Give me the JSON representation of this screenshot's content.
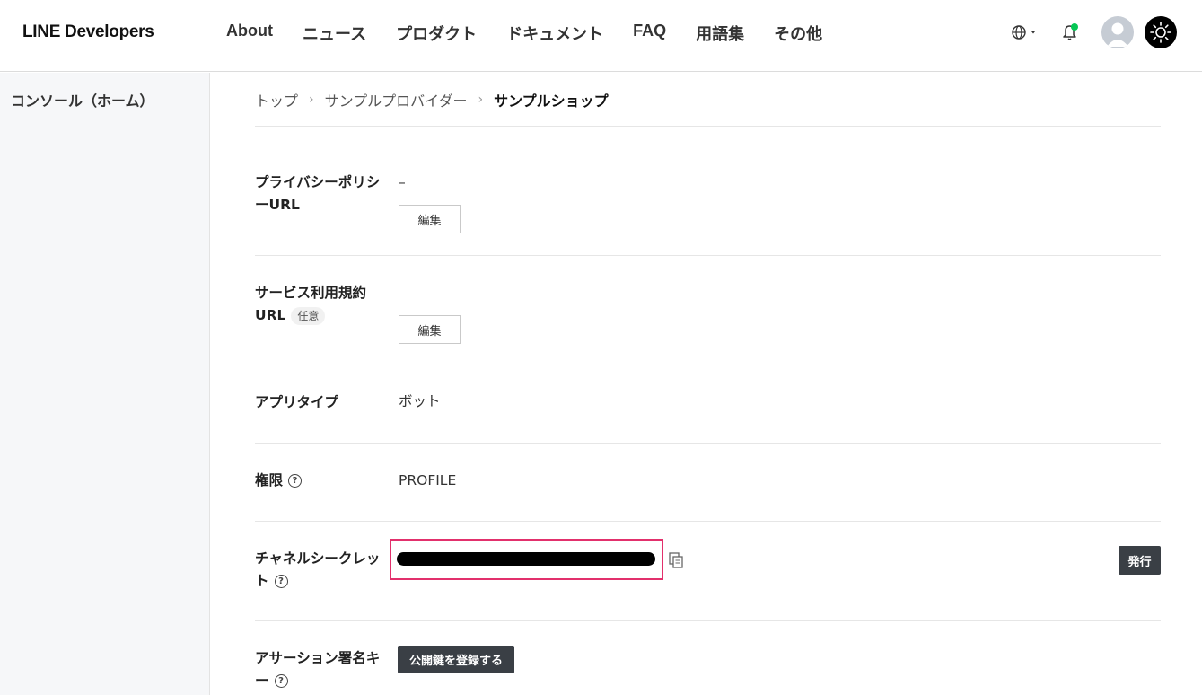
{
  "header": {
    "logo": "LINE Developers",
    "nav": [
      "About",
      "ニュース",
      "プロダクト",
      "ドキュメント",
      "FAQ",
      "用語集",
      "その他"
    ],
    "icons": {
      "globe": "globe-icon",
      "bell": "bell-icon",
      "avatar": "avatar",
      "theme": "sun-icon"
    },
    "colors": {
      "notification_dot": "#06c755"
    }
  },
  "sidebar": {
    "items": [
      {
        "label": "コンソール（ホーム）"
      }
    ]
  },
  "breadcrumb": {
    "items": [
      "トップ",
      "サンプルプロバイダー",
      "サンプルショップ"
    ],
    "separator": "›"
  },
  "settings": {
    "privacy_policy": {
      "label": "プライバシーポリシーURL",
      "value": "–",
      "edit_label": "編集"
    },
    "terms": {
      "label_line1": "サービス利用規約",
      "label_line2": "URL",
      "badge": "任意",
      "edit_label": "編集"
    },
    "app_type": {
      "label": "アプリタイプ",
      "value": "ボット"
    },
    "permissions": {
      "label": "権限",
      "value": "PROFILE",
      "help": "?"
    },
    "channel_secret": {
      "label_line1": "チャネルシークレッ",
      "label_line2": "ト",
      "help": "?",
      "issue_label": "発行",
      "highlight_color": "#e2306c"
    },
    "assertion_key": {
      "label_line1": "アサーション署名キ",
      "label_line2": "ー",
      "help": "?",
      "register_label": "公開鍵を登録する"
    }
  }
}
